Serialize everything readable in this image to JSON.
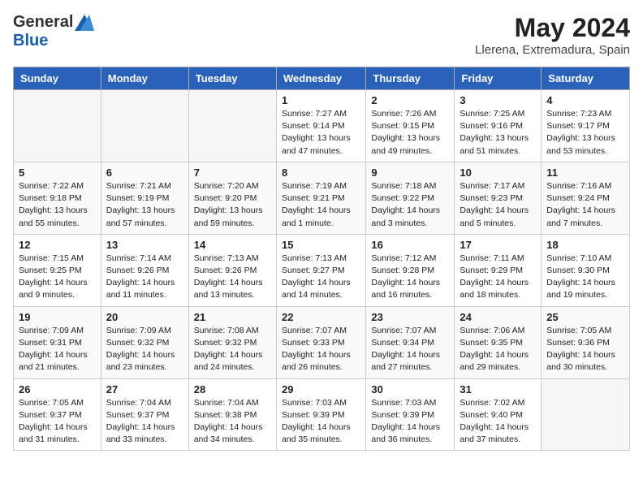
{
  "logo": {
    "general": "General",
    "blue": "Blue"
  },
  "title": {
    "month": "May 2024",
    "location": "Llerena, Extremadura, Spain"
  },
  "weekdays": [
    "Sunday",
    "Monday",
    "Tuesday",
    "Wednesday",
    "Thursday",
    "Friday",
    "Saturday"
  ],
  "weeks": [
    [
      {
        "day": "",
        "empty": true
      },
      {
        "day": "",
        "empty": true
      },
      {
        "day": "",
        "empty": true
      },
      {
        "day": "1",
        "sunrise": "7:27 AM",
        "sunset": "9:14 PM",
        "daylight": "13 hours and 47 minutes."
      },
      {
        "day": "2",
        "sunrise": "7:26 AM",
        "sunset": "9:15 PM",
        "daylight": "13 hours and 49 minutes."
      },
      {
        "day": "3",
        "sunrise": "7:25 AM",
        "sunset": "9:16 PM",
        "daylight": "13 hours and 51 minutes."
      },
      {
        "day": "4",
        "sunrise": "7:23 AM",
        "sunset": "9:17 PM",
        "daylight": "13 hours and 53 minutes."
      }
    ],
    [
      {
        "day": "5",
        "sunrise": "7:22 AM",
        "sunset": "9:18 PM",
        "daylight": "13 hours and 55 minutes."
      },
      {
        "day": "6",
        "sunrise": "7:21 AM",
        "sunset": "9:19 PM",
        "daylight": "13 hours and 57 minutes."
      },
      {
        "day": "7",
        "sunrise": "7:20 AM",
        "sunset": "9:20 PM",
        "daylight": "13 hours and 59 minutes."
      },
      {
        "day": "8",
        "sunrise": "7:19 AM",
        "sunset": "9:21 PM",
        "daylight": "14 hours and 1 minute."
      },
      {
        "day": "9",
        "sunrise": "7:18 AM",
        "sunset": "9:22 PM",
        "daylight": "14 hours and 3 minutes."
      },
      {
        "day": "10",
        "sunrise": "7:17 AM",
        "sunset": "9:23 PM",
        "daylight": "14 hours and 5 minutes."
      },
      {
        "day": "11",
        "sunrise": "7:16 AM",
        "sunset": "9:24 PM",
        "daylight": "14 hours and 7 minutes."
      }
    ],
    [
      {
        "day": "12",
        "sunrise": "7:15 AM",
        "sunset": "9:25 PM",
        "daylight": "14 hours and 9 minutes."
      },
      {
        "day": "13",
        "sunrise": "7:14 AM",
        "sunset": "9:26 PM",
        "daylight": "14 hours and 11 minutes."
      },
      {
        "day": "14",
        "sunrise": "7:13 AM",
        "sunset": "9:26 PM",
        "daylight": "14 hours and 13 minutes."
      },
      {
        "day": "15",
        "sunrise": "7:13 AM",
        "sunset": "9:27 PM",
        "daylight": "14 hours and 14 minutes."
      },
      {
        "day": "16",
        "sunrise": "7:12 AM",
        "sunset": "9:28 PM",
        "daylight": "14 hours and 16 minutes."
      },
      {
        "day": "17",
        "sunrise": "7:11 AM",
        "sunset": "9:29 PM",
        "daylight": "14 hours and 18 minutes."
      },
      {
        "day": "18",
        "sunrise": "7:10 AM",
        "sunset": "9:30 PM",
        "daylight": "14 hours and 19 minutes."
      }
    ],
    [
      {
        "day": "19",
        "sunrise": "7:09 AM",
        "sunset": "9:31 PM",
        "daylight": "14 hours and 21 minutes."
      },
      {
        "day": "20",
        "sunrise": "7:09 AM",
        "sunset": "9:32 PM",
        "daylight": "14 hours and 23 minutes."
      },
      {
        "day": "21",
        "sunrise": "7:08 AM",
        "sunset": "9:32 PM",
        "daylight": "14 hours and 24 minutes."
      },
      {
        "day": "22",
        "sunrise": "7:07 AM",
        "sunset": "9:33 PM",
        "daylight": "14 hours and 26 minutes."
      },
      {
        "day": "23",
        "sunrise": "7:07 AM",
        "sunset": "9:34 PM",
        "daylight": "14 hours and 27 minutes."
      },
      {
        "day": "24",
        "sunrise": "7:06 AM",
        "sunset": "9:35 PM",
        "daylight": "14 hours and 29 minutes."
      },
      {
        "day": "25",
        "sunrise": "7:05 AM",
        "sunset": "9:36 PM",
        "daylight": "14 hours and 30 minutes."
      }
    ],
    [
      {
        "day": "26",
        "sunrise": "7:05 AM",
        "sunset": "9:37 PM",
        "daylight": "14 hours and 31 minutes."
      },
      {
        "day": "27",
        "sunrise": "7:04 AM",
        "sunset": "9:37 PM",
        "daylight": "14 hours and 33 minutes."
      },
      {
        "day": "28",
        "sunrise": "7:04 AM",
        "sunset": "9:38 PM",
        "daylight": "14 hours and 34 minutes."
      },
      {
        "day": "29",
        "sunrise": "7:03 AM",
        "sunset": "9:39 PM",
        "daylight": "14 hours and 35 minutes."
      },
      {
        "day": "30",
        "sunrise": "7:03 AM",
        "sunset": "9:39 PM",
        "daylight": "14 hours and 36 minutes."
      },
      {
        "day": "31",
        "sunrise": "7:02 AM",
        "sunset": "9:40 PM",
        "daylight": "14 hours and 37 minutes."
      },
      {
        "day": "",
        "empty": true
      }
    ]
  ]
}
